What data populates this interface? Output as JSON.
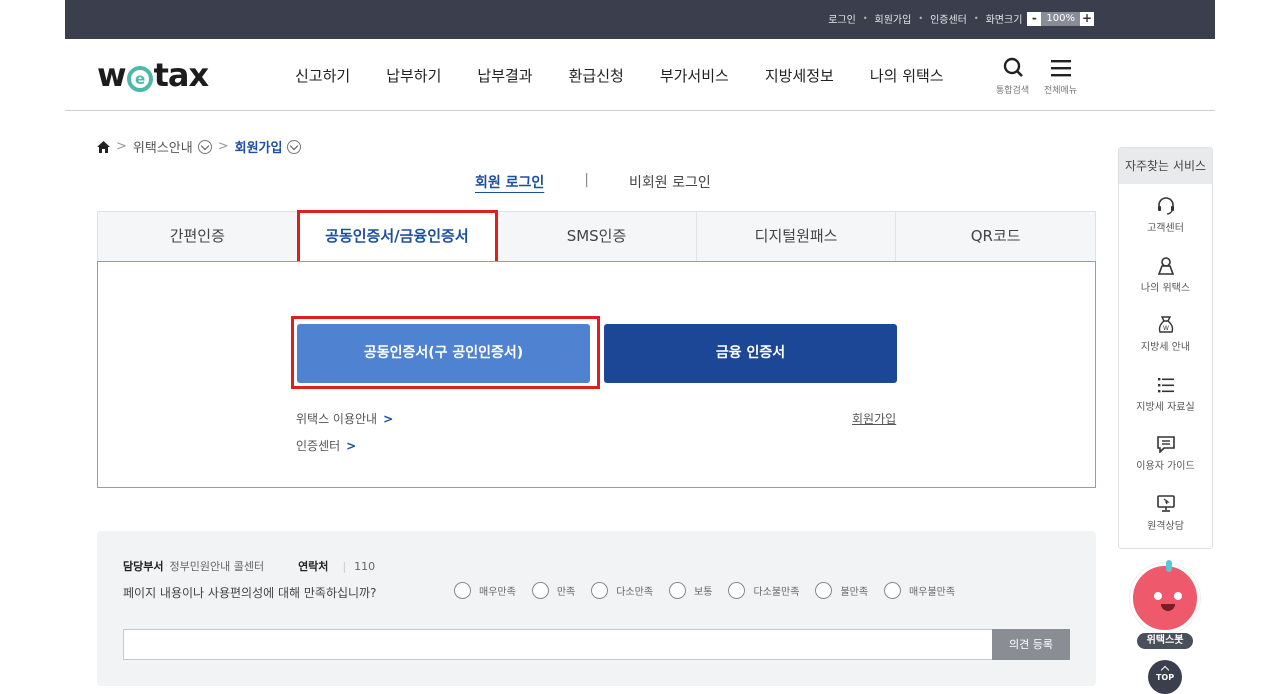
{
  "utility_bar": {
    "login": "로그인",
    "signup": "회원가입",
    "cert_center": "인증센터",
    "zoom_label": "화면크기",
    "zoom_minus": "-",
    "zoom_value": "100%",
    "zoom_plus": "+"
  },
  "header": {
    "logo_w": "w",
    "logo_e": "e",
    "logo_rest": "tax",
    "menu": [
      "신고하기",
      "납부하기",
      "납부결과",
      "환급신청",
      "부가서비스",
      "지방세정보",
      "나의 위택스"
    ],
    "search_label": "통합검색",
    "all_menu_label": "전체메뉴"
  },
  "breadcrumb": {
    "level1": "위택스안내",
    "current": "회원가입"
  },
  "login_switch": {
    "member": "회원 로그인",
    "divider": "|",
    "nonmember": "비회원 로그인"
  },
  "tabs": [
    "간편인증",
    "공동인증서/금융인증서",
    "SMS인증",
    "디지털원패스",
    "QR코드"
  ],
  "active_tab": "공동인증서/금융인증서",
  "panel": {
    "public_cert_button": "공동인증서(구 공인인증서)",
    "financial_cert_button": "금융 인증서",
    "guide_link": "위택스 이용안내",
    "cert_center_link": "인증센터",
    "signup_link": "회원가입",
    "arrow": ">"
  },
  "survey": {
    "dept_label": "담당부서",
    "dept_value": "정부민원안내 콜센터",
    "contact_label": "연락처",
    "contact_value": "110",
    "question": "페이지 내용이나 사용편의성에 대해 만족하십니까?",
    "options": [
      "매우만족",
      "만족",
      "다소만족",
      "보통",
      "다소불만족",
      "불만족",
      "매우불만족"
    ],
    "submit": "의견 등록"
  },
  "sidebar": {
    "title": "자주찾는 서비스",
    "items": [
      "고객센터",
      "나의 위택스",
      "지방세 안내",
      "지방세 자료실",
      "이용자 가이드",
      "원격상담"
    ]
  },
  "bot_label": "위택스봇",
  "top_label": "TOP",
  "colors": {
    "highlight_box": "#e01e1e",
    "public_cert_button": "#4f83d1",
    "financial_cert_button": "#1c4797",
    "active_text": "#1d4fa0"
  }
}
